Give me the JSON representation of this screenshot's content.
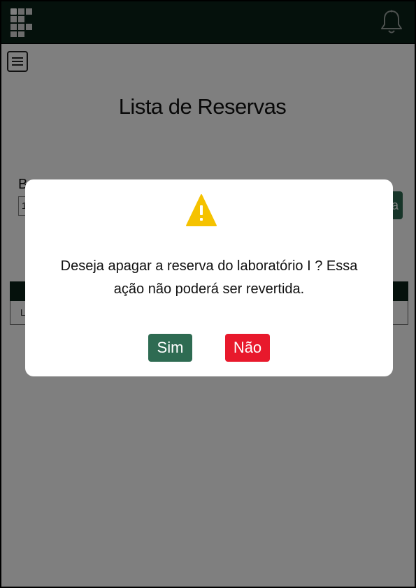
{
  "page": {
    "title": "Lista de Reservas",
    "field_label": "B",
    "field_value": "1",
    "search_label": "a",
    "row_text": "L"
  },
  "dialog": {
    "message": "Deseja apagar a reserva do laboratório I ? Essa ação não poderá ser revertida.",
    "confirm_label": "Sim",
    "cancel_label": "Não"
  },
  "icons": {
    "logo": "institute-logo-icon",
    "notifications": "bell-icon",
    "menu": "hamburger-menu-icon",
    "warning": "warning-triangle-icon"
  },
  "colors": {
    "topbar": "#0b2218",
    "primary": "#2e6b52",
    "danger": "#e8192c",
    "warning": "#f5c200"
  }
}
